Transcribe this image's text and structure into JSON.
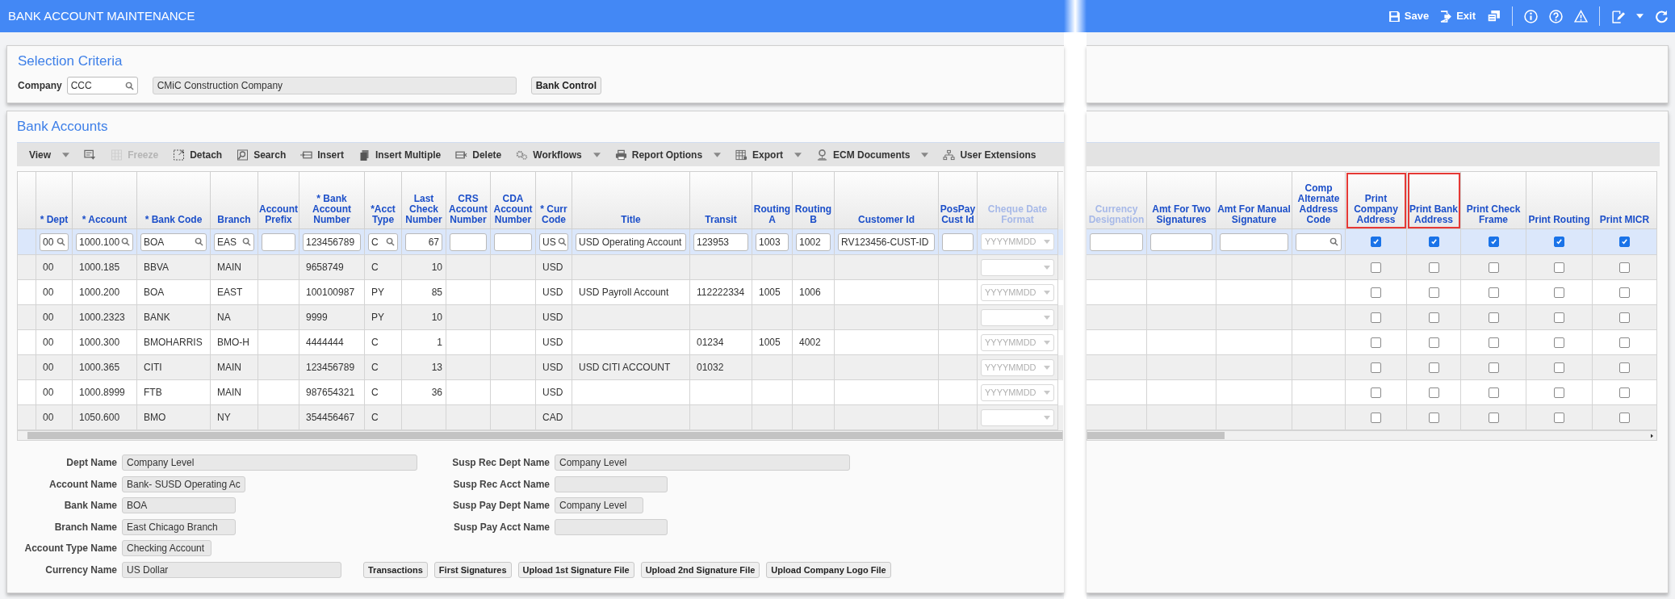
{
  "window": {
    "title": "BANK ACCOUNT MAINTENANCE"
  },
  "header_actions": [
    {
      "label": "Save"
    },
    {
      "label": "Exit"
    }
  ],
  "selection_criteria": {
    "title": "Selection Criteria",
    "company_label": "Company",
    "company_code": "CCC",
    "company_name": "CMiC Construction Company",
    "button": "Bank Control"
  },
  "bank_accounts": {
    "title": "Bank Accounts",
    "toolbar": [
      {
        "kind": "button",
        "label": "View",
        "dropdown": true,
        "disabled": false
      },
      {
        "kind": "icon",
        "dropdown": false,
        "disabled": false
      },
      {
        "kind": "button",
        "label": "Freeze",
        "dropdown": false,
        "disabled": true
      },
      {
        "kind": "button",
        "label": "Detach",
        "dropdown": false,
        "disabled": false
      },
      {
        "kind": "button",
        "label": "Search",
        "dropdown": false,
        "disabled": false
      },
      {
        "kind": "button",
        "label": "Insert",
        "dropdown": false,
        "disabled": false
      },
      {
        "kind": "button",
        "label": "Insert Multiple",
        "dropdown": false,
        "disabled": false
      },
      {
        "kind": "button",
        "label": "Delete",
        "dropdown": false,
        "disabled": false
      },
      {
        "kind": "button",
        "label": "Workflows",
        "dropdown": true,
        "disabled": false
      },
      {
        "kind": "button",
        "label": "Report Options",
        "dropdown": true,
        "disabled": false
      },
      {
        "kind": "button",
        "label": "Export",
        "dropdown": true,
        "disabled": false
      },
      {
        "kind": "button",
        "label": "ECM Documents",
        "dropdown": true,
        "disabled": false
      },
      {
        "kind": "button",
        "label": "User Extensions",
        "dropdown": false,
        "disabled": false
      }
    ],
    "table": {
      "columns": [
        {
          "label": "* Dept",
          "kind": "text",
          "highlighted": false
        },
        {
          "label": "* Account",
          "kind": "text",
          "highlighted": false
        },
        {
          "label": "* Bank Code",
          "kind": "text",
          "highlighted": false
        },
        {
          "label": "Branch",
          "kind": "text",
          "highlighted": false
        },
        {
          "label": "Account Prefix",
          "kind": "text",
          "highlighted": false
        },
        {
          "label": "* Bank Account Number",
          "kind": "text",
          "highlighted": false
        },
        {
          "label": "*Acct Type",
          "kind": "text",
          "highlighted": false
        },
        {
          "label": "Last Check Number",
          "kind": "number",
          "highlighted": false
        },
        {
          "label": "CRS Account Number",
          "kind": "text",
          "highlighted": false
        },
        {
          "label": "CDA Account Number",
          "kind": "text",
          "highlighted": false
        },
        {
          "label": "* Curr Code",
          "kind": "text",
          "highlighted": false
        },
        {
          "label": "Title",
          "kind": "text",
          "highlighted": false
        },
        {
          "label": "Transit",
          "kind": "text",
          "highlighted": false
        },
        {
          "label": "Routing A",
          "kind": "text",
          "highlighted": false
        },
        {
          "label": "Routing B",
          "kind": "text",
          "highlighted": false
        },
        {
          "label": "Customer Id",
          "kind": "text",
          "highlighted": false
        },
        {
          "label": "PosPay Cust Id",
          "kind": "text",
          "highlighted": false
        },
        {
          "label": "Cheque Date Format",
          "kind": "select",
          "highlighted": false
        }
      ],
      "columns_continued": [
        {
          "label": "Currency Designation",
          "kind": "text",
          "highlighted": false
        },
        {
          "label": "Amt For Two Signatures",
          "kind": "text",
          "highlighted": false
        },
        {
          "label": "Amt For Manual Signature",
          "kind": "text",
          "highlighted": false
        },
        {
          "label": "Comp Alternate Address Code",
          "kind": "text",
          "highlighted": false
        },
        {
          "label": "Print Company Address",
          "kind": "checkbox",
          "highlighted": true
        },
        {
          "label": "Print Bank Address",
          "kind": "checkbox",
          "highlighted": true
        },
        {
          "label": "Print Check Frame",
          "kind": "checkbox",
          "highlighted": false
        },
        {
          "label": "Print Routing",
          "kind": "checkbox",
          "highlighted": false
        },
        {
          "label": "Print MICR",
          "kind": "checkbox",
          "highlighted": false
        }
      ],
      "rows": [
        {
          "selected": true,
          "cells": {
            "dept": {
              "kind": "search",
              "value": "00"
            },
            "account": {
              "kind": "search",
              "value": "1000.100"
            },
            "bank_code": {
              "kind": "search",
              "value": "BOA"
            },
            "branch": {
              "kind": "search",
              "value": "EAS"
            },
            "account_prefix": {
              "kind": "input"
            },
            "bank_account_number": {
              "kind": "input",
              "value": "123456789"
            },
            "acct_type": {
              "kind": "search",
              "value": "C"
            },
            "last_check_number": {
              "kind": "input",
              "value": "67"
            },
            "crs_account_number": {
              "kind": "input"
            },
            "cda_account_number": {
              "kind": "input"
            },
            "curr_code": {
              "kind": "search",
              "value": "US"
            },
            "title": {
              "kind": "input",
              "value": "USD Operating Account"
            },
            "transit": {
              "kind": "input",
              "value": "123953"
            },
            "routing_a": {
              "kind": "input",
              "value": "1003"
            },
            "routing_b": {
              "kind": "input",
              "value": "1002"
            },
            "customer_id": {
              "kind": "input",
              "value": "RV123456-CUST-ID"
            },
            "pospay_cust_id": {
              "kind": "input"
            },
            "cheque_date_format": {
              "kind": "select",
              "placeholder": "YYYYMMDD"
            },
            "currency_designation": {
              "kind": "input"
            },
            "amt_for_two_signatures": {
              "kind": "input"
            },
            "amt_for_manual_signature": {
              "kind": "input"
            },
            "comp_alternate_address_code": {
              "kind": "search"
            },
            "print_company_address": true,
            "print_bank_address": true,
            "print_check_frame": true,
            "print_routing": true,
            "print_micr": true
          }
        },
        {
          "selected": false,
          "cells": {
            "dept": "00",
            "account": "1000.185",
            "bank_code": "BBVA",
            "branch": "MAIN",
            "bank_account_number": "9658749",
            "acct_type": "C",
            "last_check_number": "10",
            "curr_code": "USD",
            "cheque_date_format": {
              "kind": "select"
            },
            "print_company_address": false,
            "print_bank_address": false,
            "print_check_frame": false,
            "print_routing": false,
            "print_micr": false
          }
        },
        {
          "selected": false,
          "cells": {
            "dept": "00",
            "account": "1000.200",
            "bank_code": "BOA",
            "branch": "EAST",
            "bank_account_number": "100100987",
            "acct_type": "PY",
            "last_check_number": "85",
            "curr_code": "USD",
            "title": "USD Payroll Account",
            "transit": "112222334",
            "routing_a": "1005",
            "routing_b": "1006",
            "cheque_date_format": {
              "kind": "select",
              "placeholder": "YYYYMMDD"
            },
            "print_company_address": false,
            "print_bank_address": false,
            "print_check_frame": false,
            "print_routing": false,
            "print_micr": false
          }
        },
        {
          "selected": false,
          "cells": {
            "dept": "00",
            "account": "1000.2323",
            "bank_code": "BANK",
            "branch": "NA",
            "bank_account_number": "9999",
            "acct_type": "PY",
            "last_check_number": "10",
            "curr_code": "USD",
            "cheque_date_format": {
              "kind": "select"
            },
            "print_company_address": false,
            "print_bank_address": false,
            "print_check_frame": false,
            "print_routing": false,
            "print_micr": false
          }
        },
        {
          "selected": false,
          "cells": {
            "dept": "00",
            "account": "1000.300",
            "bank_code": "BMOHARRIS",
            "branch": "BMO-H",
            "bank_account_number": "4444444",
            "acct_type": "C",
            "last_check_number": "1",
            "curr_code": "USD",
            "transit": "01234",
            "routing_a": "1005",
            "routing_b": "4002",
            "cheque_date_format": {
              "kind": "select",
              "placeholder": "YYYYMMDD"
            },
            "print_company_address": false,
            "print_bank_address": false,
            "print_check_frame": false,
            "print_routing": false,
            "print_micr": false
          }
        },
        {
          "selected": false,
          "cells": {
            "dept": "00",
            "account": "1000.365",
            "bank_code": "CITI",
            "branch": "MAIN",
            "bank_account_number": "123456789",
            "acct_type": "C",
            "last_check_number": "13",
            "curr_code": "USD",
            "title": "USD CITI ACCOUNT",
            "transit": "01032",
            "cheque_date_format": {
              "kind": "select",
              "placeholder": "YYYYMMDD"
            },
            "print_company_address": false,
            "print_bank_address": false,
            "print_check_frame": false,
            "print_routing": false,
            "print_micr": false
          }
        },
        {
          "selected": false,
          "cells": {
            "dept": "00",
            "account": "1000.8999",
            "bank_code": "FTB",
            "branch": "MAIN",
            "bank_account_number": "987654321",
            "acct_type": "C",
            "last_check_number": "36",
            "curr_code": "USD",
            "cheque_date_format": {
              "kind": "select",
              "placeholder": "YYYYMMDD"
            },
            "print_company_address": false,
            "print_bank_address": false,
            "print_check_frame": false,
            "print_routing": false,
            "print_micr": false
          }
        },
        {
          "selected": false,
          "cells": {
            "dept": "00",
            "account": "1050.600",
            "bank_code": "BMO",
            "branch": "NY",
            "bank_account_number": "354456467",
            "acct_type": "C",
            "curr_code": "CAD",
            "cheque_date_format": {
              "kind": "select"
            },
            "print_company_address": false,
            "print_bank_address": false,
            "print_check_frame": false,
            "print_routing": false,
            "print_micr": false
          }
        }
      ]
    },
    "details": {
      "fields": [
        {
          "label": "Dept Name",
          "value": "Company Level"
        },
        {
          "label": "Account Name",
          "value": "Bank- SUSD Operating Ac"
        },
        {
          "label": "Bank Name",
          "value": "BOA"
        },
        {
          "label": "Branch Name",
          "value": "East Chicago Branch"
        },
        {
          "label": "Account Type Name",
          "value": "Checking Account"
        },
        {
          "label": "Currency Name",
          "value": "US Dollar"
        }
      ],
      "fields_right": [
        {
          "label": "Susp Rec Dept Name",
          "value": "Company Level"
        },
        {
          "label": "Susp Rec Acct Name"
        },
        {
          "label": "Susp Pay Dept Name",
          "value": "Company Level"
        },
        {
          "label": "Susp Pay Acct Name"
        }
      ],
      "buttons": [
        "Transactions",
        "First Signatures",
        "Upload 1st Signature File",
        "Upload 2nd Signature File",
        "Upload Company Logo File"
      ]
    }
  }
}
